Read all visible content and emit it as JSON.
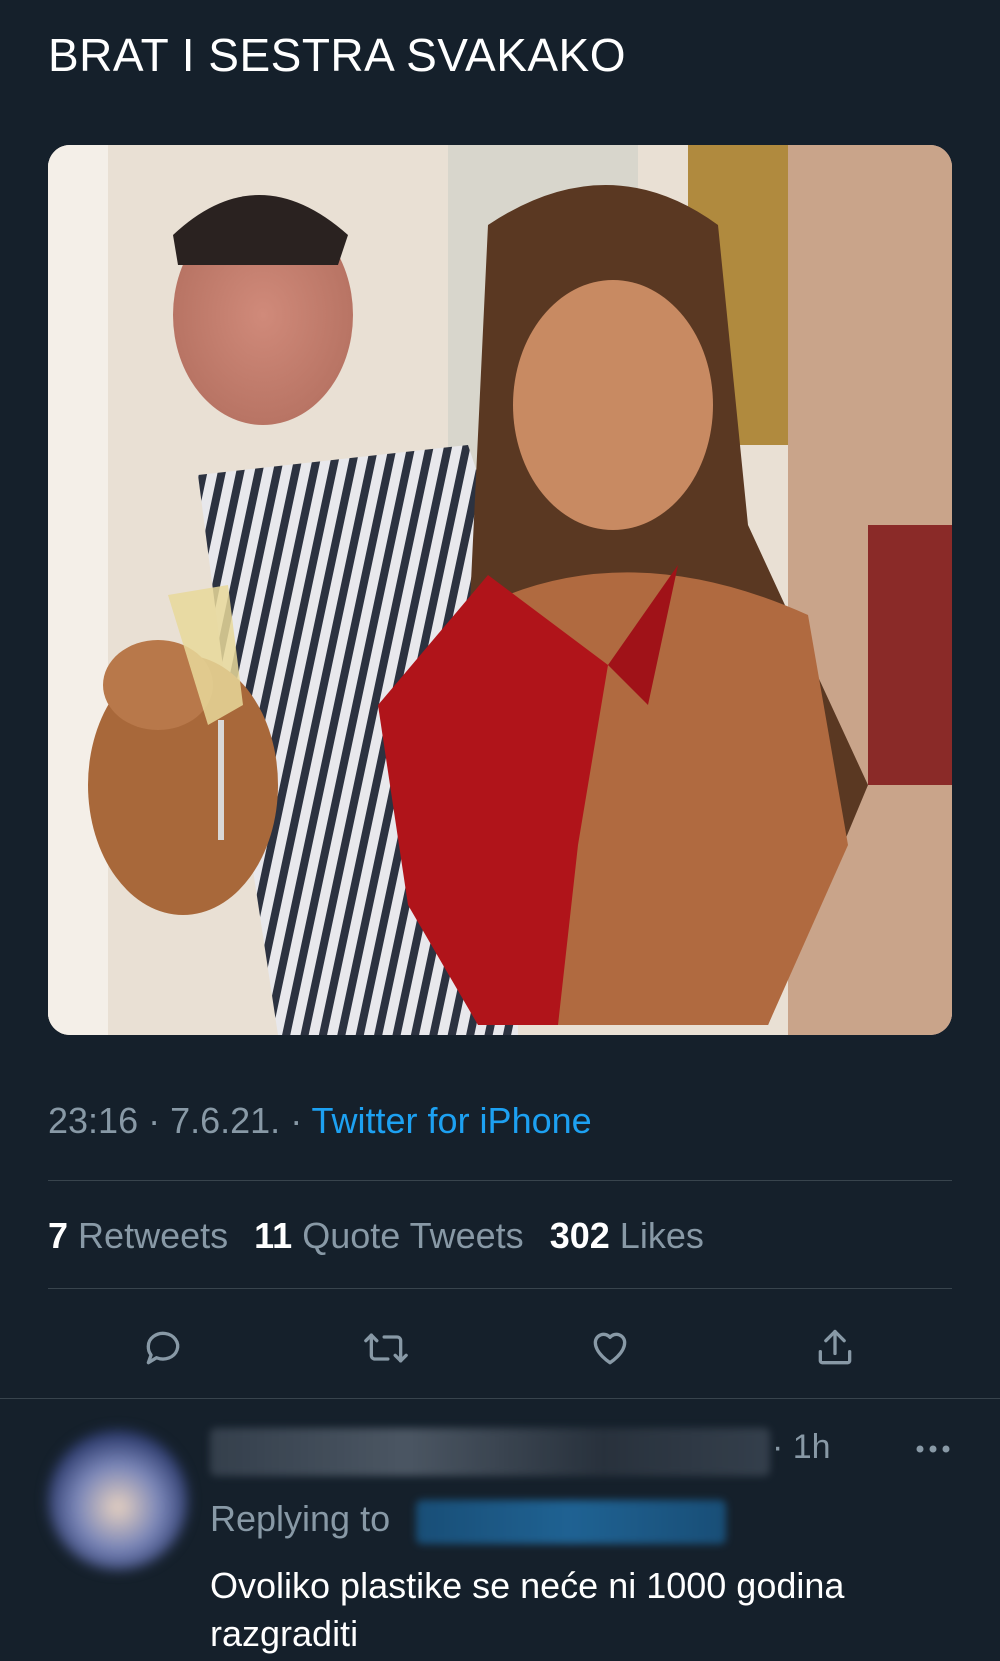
{
  "tweet": {
    "text": "BRAT I SESTRA SVAKAKO",
    "time": "23:16",
    "date": "7.6.21.",
    "source": "Twitter for iPhone",
    "sep": " · "
  },
  "stats": {
    "retweets_count": "7",
    "retweets_label": "Retweets",
    "quotes_count": "11",
    "quotes_label": "Quote Tweets",
    "likes_count": "302",
    "likes_label": "Likes"
  },
  "actions": {
    "icons": [
      "reply-icon",
      "retweet-icon",
      "like-icon",
      "share-icon"
    ]
  },
  "reply": {
    "time": "· 1h",
    "replying_label": "Replying to",
    "text": "Ovoliko plastike se neće ni 1000 godina razgraditi"
  },
  "colors": {
    "background": "#15202b",
    "secondary_text": "#8899a6",
    "accent": "#1da1f2",
    "divider": "#38444d"
  }
}
